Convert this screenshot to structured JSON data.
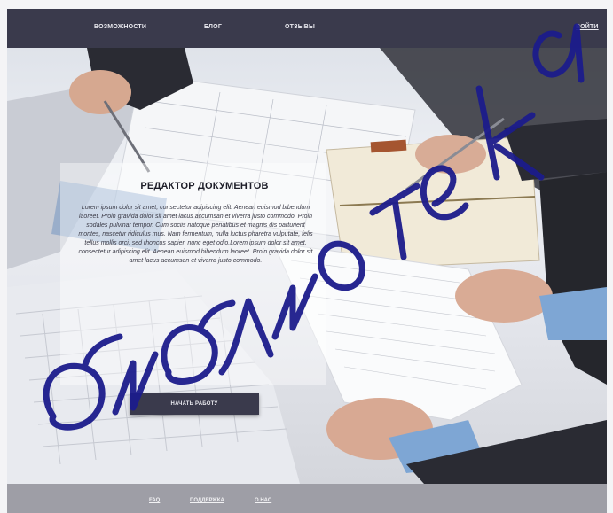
{
  "nav": {
    "features": "ВОЗМОЖНОСТИ",
    "blog": "БЛОГ",
    "reviews": "ОТЗЫВЫ",
    "login": "ВОЙТИ"
  },
  "hero": {
    "title": "РЕДАКТОР ДОКУМЕНТОВ",
    "body": "Lorem ipsum dolor sit amet, consectetur adipiscing elit. Aenean euismod bibendum laoreet. Proin gravida dolor sit amet lacus accumsan et viverra justo commodo. Proin sodales pulvinar tempor. Cum sociis natoque penatibus et magnis dis parturient montes, nascetur ridiculus mus. Nam fermentum, nulla luctus pharetra vulputate, felis tellus mollis orci, sed rhoncus sapien nunc eget odio.Lorem ipsum dolor sit amet, consectetur adipiscing elit. Aenean euismod bibendum laoreet. Proin gravida dolor sit amet lacus accumsan et viverra justo commodo.",
    "cta": "НАЧАТЬ РАБОТУ"
  },
  "footer": {
    "faq": "FAQ",
    "support": "ПОДДЕРЖКА",
    "about": "О НАС"
  },
  "colors": {
    "nav_bg": "#3a3a4c",
    "footer_bg": "#9e9ea6",
    "button_bg": "#3a3a4c",
    "watermark": "#1c1c8c"
  }
}
